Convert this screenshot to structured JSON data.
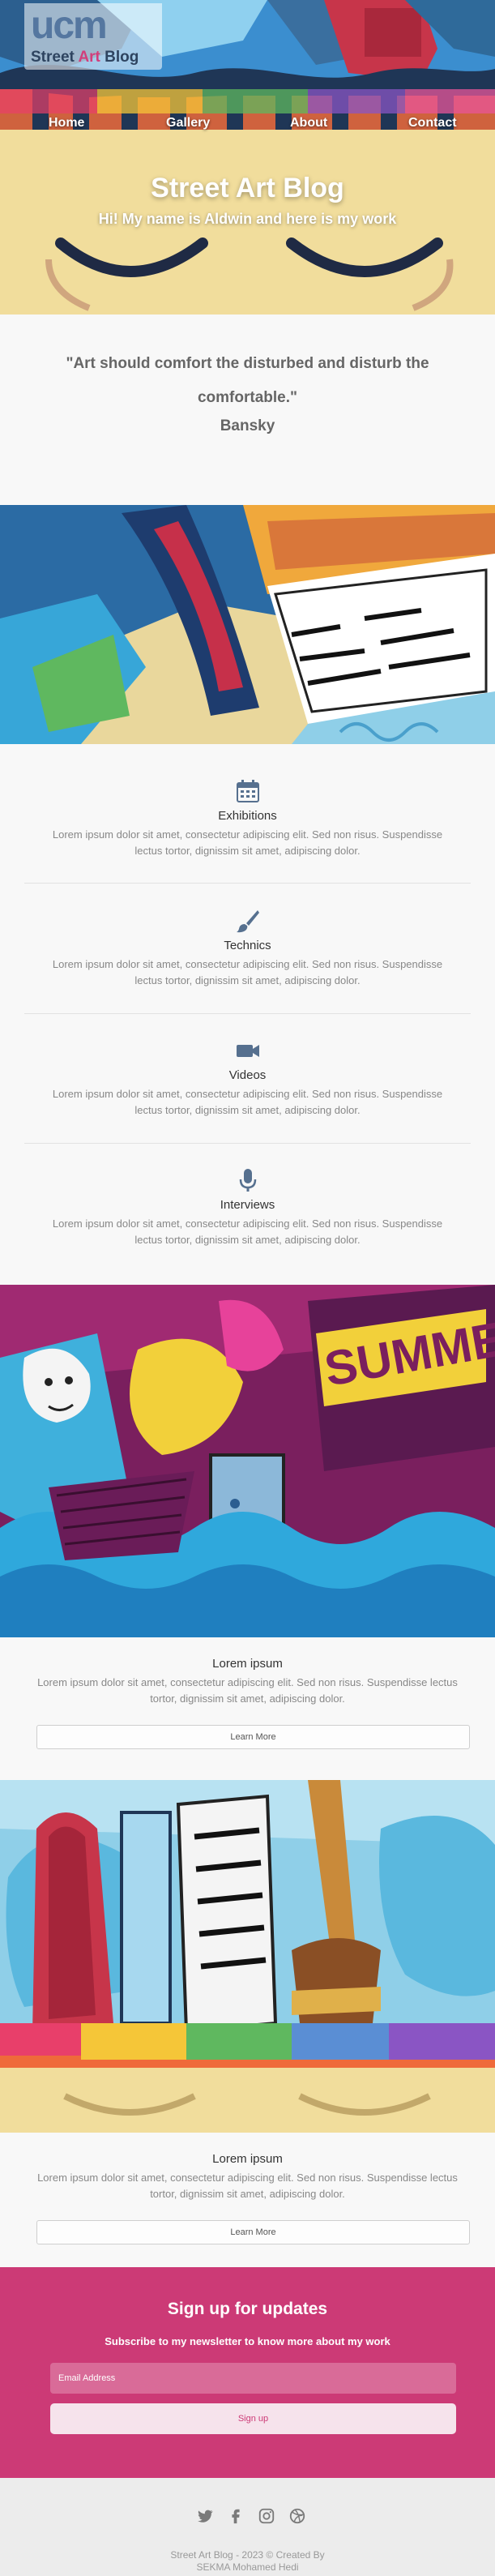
{
  "brand": {
    "logo_mark": "ucm",
    "logo_text_a": "Street ",
    "logo_text_b": "Art",
    "logo_text_c": " Blog"
  },
  "nav": [
    {
      "label": "Home"
    },
    {
      "label": "Gallery"
    },
    {
      "label": "About"
    },
    {
      "label": "Contact"
    }
  ],
  "hero": {
    "title": "Street Art Blog",
    "subtitle": "Hi! My name is Aldwin and here is my work"
  },
  "quote": {
    "text": "\"Art should comfort the disturbed and disturb the comfortable.\"",
    "author": "Bansky"
  },
  "features": [
    {
      "icon": "calendar-icon",
      "title": "Exhibitions",
      "desc": "Lorem ipsum dolor sit amet, consectetur adipiscing elit. Sed non risus. Suspendisse lectus tortor, dignissim sit amet, adipiscing dolor."
    },
    {
      "icon": "paintbrush-icon",
      "title": "Technics",
      "desc": "Lorem ipsum dolor sit amet, consectetur adipiscing elit. Sed non risus. Suspendisse lectus tortor, dignissim sit amet, adipiscing dolor."
    },
    {
      "icon": "video-camera-icon",
      "title": "Videos",
      "desc": "Lorem ipsum dolor sit amet, consectetur adipiscing elit. Sed non risus. Suspendisse lectus tortor, dignissim sit amet, adipiscing dolor."
    },
    {
      "icon": "microphone-icon",
      "title": "Interviews",
      "desc": "Lorem ipsum dolor sit amet, consectetur adipiscing elit. Sed non risus. Suspendisse lectus tortor, dignissim sit amet, adipiscing dolor."
    }
  ],
  "cards": [
    {
      "title": "Lorem ipsum",
      "desc": "Lorem ipsum dolor sit amet, consectetur adipiscing elit. Sed non risus. Suspendisse lectus tortor, dignissim sit amet, adipiscing dolor.",
      "button": "Learn More"
    },
    {
      "title": "Lorem ipsum",
      "desc": "Lorem ipsum dolor sit amet, consectetur adipiscing elit. Sed non risus. Suspendisse lectus tortor, dignissim sit amet, adipiscing dolor.",
      "button": "Learn More"
    }
  ],
  "signup": {
    "title": "Sign up for updates",
    "subtitle": "Subscribe to my newsletter to know more about my work",
    "email_placeholder": "Email Address",
    "button": "Sign up"
  },
  "footer": {
    "socials": [
      "twitter-icon",
      "facebook-icon",
      "instagram-icon",
      "dribbble-icon"
    ],
    "line1": "Street Art Blog - 2023 © Created By",
    "line2": "SEKMA Mohamed Hedi"
  },
  "colors": {
    "accent": "#cc3a76",
    "icon": "#56708f",
    "background": "#f8f8f8",
    "footer": "#ececec"
  }
}
